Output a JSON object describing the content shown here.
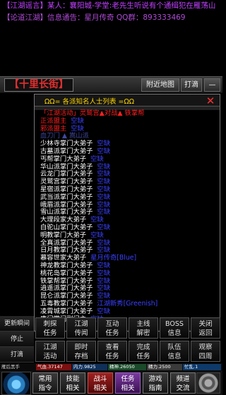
{
  "ticker": {
    "line1": "【江湖谣言】某人：襄阳城-学堂:老先生听说有个通缉犯在雁荡山",
    "line2": "【论道江湖】信息通告：星月传奇 QQ群：893333469"
  },
  "location": {
    "name": "【十里长街】",
    "map_button": "附近地图",
    "fight_button": "打滴",
    "collapse_button": "—"
  },
  "panel": {
    "title": "ΩΩ= 各派知名人士列表 =ΩΩ",
    "close": "✕",
    "rows": [
      {
        "name": "「江湖活动」灵鹫宫▲对战▲ 铁掌帮",
        "value": "",
        "style": "activity"
      },
      {
        "name": "正派盟主",
        "value": "空缺",
        "style": "red"
      },
      {
        "name": "邪派盟主",
        "value": "空缺",
        "style": "red"
      },
      {
        "name": "血刀门 ▲ 嵩山派",
        "value": "",
        "style": "dim"
      },
      {
        "name": "少林寺掌门大弟子",
        "value": "空缺",
        "style": "normal"
      },
      {
        "name": "古墓派掌门大弟子",
        "value": "空缺",
        "style": "normal"
      },
      {
        "name": "丐帮掌门大弟子",
        "value": "空缺",
        "style": "normal"
      },
      {
        "name": "华山派掌门大弟子",
        "value": "空缺",
        "style": "normal"
      },
      {
        "name": "云龙门掌门大弟子",
        "value": "空缺",
        "style": "normal"
      },
      {
        "name": "灵鹫宫掌门大弟子",
        "value": "空缺",
        "style": "normal"
      },
      {
        "name": "星宿派掌门大弟子",
        "value": "空缺",
        "style": "normal"
      },
      {
        "name": "武当派掌门大弟子",
        "value": "空缺",
        "style": "normal"
      },
      {
        "name": "峨眉派掌门大弟子",
        "value": "空缺",
        "style": "normal"
      },
      {
        "name": "雪山派掌门大弟子",
        "value": "空缺",
        "style": "normal"
      },
      {
        "name": "大理段家大弟子",
        "value": "空缺",
        "style": "normal"
      },
      {
        "name": "白驼山掌门大弟子",
        "value": "空缺",
        "style": "normal"
      },
      {
        "name": "明教掌门大弟子",
        "value": "空缺",
        "style": "normal"
      },
      {
        "name": "全真派掌门大弟子",
        "value": "空缺",
        "style": "normal"
      },
      {
        "name": "日月教掌门大弟子",
        "value": "空缺",
        "style": "normal"
      },
      {
        "name": "慕容世家大弟子",
        "value": "星月传奇[Blue]",
        "style": "normal"
      },
      {
        "name": "神龙教掌门大弟子",
        "value": "空缺",
        "style": "normal"
      },
      {
        "name": "桃花岛掌门大弟子",
        "value": "空缺",
        "style": "normal"
      },
      {
        "name": "铁掌帮掌门大弟子",
        "value": "空缺",
        "style": "normal"
      },
      {
        "name": "逍遥派掌门大弟子",
        "value": "空缺",
        "style": "normal"
      },
      {
        "name": "昆仑派掌门大弟子",
        "value": "空缺",
        "style": "normal"
      },
      {
        "name": "五毒教掌门大弟子",
        "value": "江湖新秀[Greenish]",
        "style": "normal"
      },
      {
        "name": "凌霄城掌门大弟子",
        "value": "空缺",
        "style": "normal"
      },
      {
        "name": "唐门掌门副门主",
        "value": "空缺",
        "style": "normal"
      }
    ]
  },
  "left_column": [
    "更新瞬间",
    "停止",
    "打滴"
  ],
  "grid": [
    [
      "刺探\n任务",
      "江湖\n传闻",
      "互动\n任务",
      "主线\n解密",
      "BOSS\n信息",
      "关闭\n返回"
    ],
    [
      "江湖\n活动",
      "即时\n存档",
      "查看\n任务",
      "完成\n任务",
      "队伍\n信息",
      "观察\n四周"
    ]
  ],
  "status": {
    "label": "雁后黑手",
    "qi": "气血.37147",
    "neili": "内力.9825",
    "jingshen": "精神.26050",
    "jingli": "精力.2500",
    "qianneng": "忙乱.1"
  },
  "bottom_nav": [
    {
      "label": "常用\n指令",
      "style": "dark"
    },
    {
      "label": "技能\n相关",
      "style": "dark"
    },
    {
      "label": "战斗\n相关",
      "style": "red"
    },
    {
      "label": "任务\n相关",
      "style": "purple"
    },
    {
      "label": "游戏\n指南",
      "style": "dark"
    },
    {
      "label": "频道\n交流",
      "style": "dark"
    }
  ]
}
